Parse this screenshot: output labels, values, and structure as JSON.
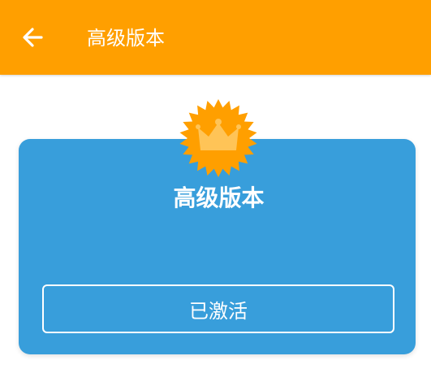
{
  "app_bar": {
    "title": "高级版本",
    "back_icon": "arrow-left-icon",
    "color": "#FF9F00"
  },
  "premium_card": {
    "badge_icon": "crown-badge-icon",
    "title": "高级版本",
    "status_button_label": "已激活",
    "card_color": "#389EDB",
    "badge_color": "#FF9F00",
    "crown_color": "#FFC457"
  }
}
